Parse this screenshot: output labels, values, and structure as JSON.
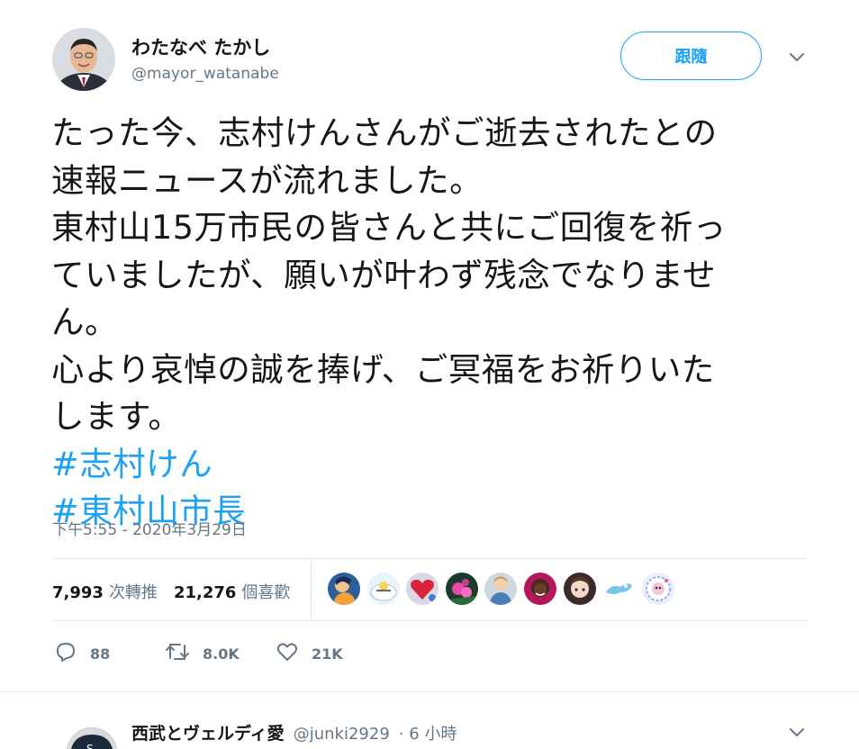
{
  "tweet": {
    "author_name": "わたなべ たかし",
    "author_handle": "@mayor_watanabe",
    "follow_label": "跟隨",
    "text_lines": [
      "たった今、志村けんさんがご逝去されたとの",
      "速報ニュースが流れました。",
      "東村山15万市民の皆さんと共にご回復を祈っ",
      "ていましたが、願いが叶わず残念でなりませ",
      "ん。",
      "心より哀悼の誠を捧げ、ご冥福をお祈りいた",
      "します。"
    ],
    "hashtags": [
      "#志村けん",
      "#東村山市長"
    ],
    "timestamp": "下午5:55 - 2020年3月29日",
    "retweet_count": "7,993",
    "retweet_label": "次轉推",
    "like_count": "21,276",
    "like_label": "個喜歡",
    "actions": {
      "reply_count": "88",
      "retweet_count": "8.0K",
      "like_count": "21K"
    }
  },
  "reply": {
    "author_name": "西武とヴェルディ愛",
    "author_handle": "@junki2929",
    "time": "· 6 小時"
  },
  "colors": {
    "accent": "#1da1f2",
    "muted": "#657786",
    "text": "#14171a",
    "divider": "#e1e8ed"
  }
}
